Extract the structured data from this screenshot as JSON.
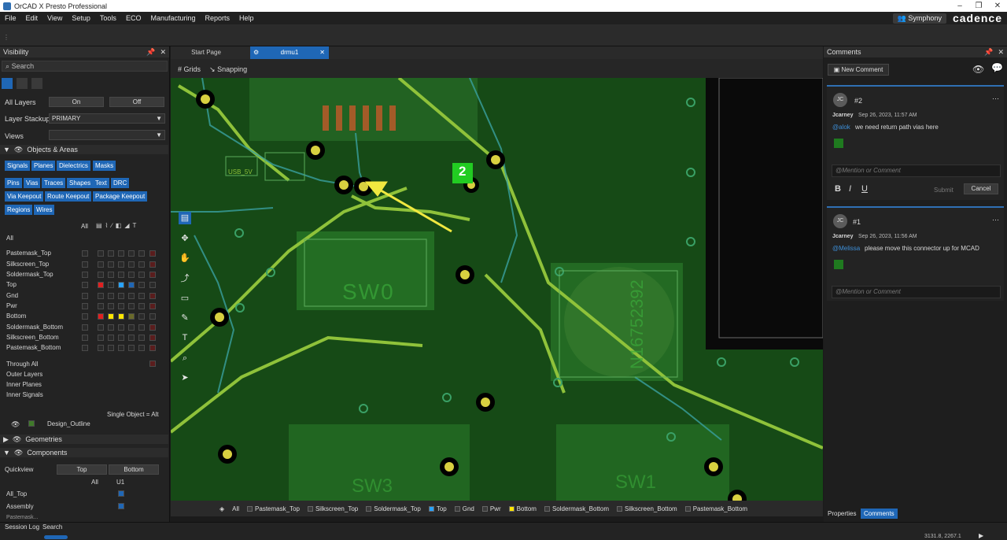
{
  "window": {
    "title": "OrCAD X Presto Professional"
  },
  "menu": [
    "File",
    "Edit",
    "View",
    "Setup",
    "Tools",
    "ECO",
    "Manufacturing",
    "Reports",
    "Help"
  ],
  "brand": {
    "symphony": "Symphony",
    "logo": "cadence"
  },
  "visibility": {
    "title": "Visibility",
    "search_placeholder": "Search",
    "all_layers_label": "All Layers",
    "on": "On",
    "off": "Off",
    "layer_stackup_label": "Layer Stackup",
    "layer_stackup_value": "PRIMARY",
    "views_label": "Views",
    "objects_areas": "Objects & Areas",
    "filters_row1": [
      "Signals",
      "Planes",
      "Dielectrics",
      "Masks"
    ],
    "filters_row2": [
      "Pins",
      "Vias",
      "Traces",
      "Shapes",
      "Text",
      "DRC"
    ],
    "filters_row3": [
      "Via Keepout",
      "Route Keepout",
      "Package Keepout"
    ],
    "filters_row4": [
      "Regions",
      "Wires"
    ],
    "all_col": "All",
    "all_row": "All",
    "layers": [
      "Pastemask_Top",
      "Silkscreen_Top",
      "Soldermask_Top",
      "Top",
      "Gnd",
      "Pwr",
      "Bottom",
      "Soldermask_Bottom",
      "Silkscreen_Bottom",
      "Pastemask_Bottom"
    ],
    "groups": [
      "Through All",
      "Outer Layers",
      "Inner Planes",
      "Inner Signals"
    ],
    "single_object": "Single Object = Alt",
    "design_outline": "Design_Outline",
    "geometries": "Geometries",
    "components": "Components",
    "quickview": "Quickview",
    "qv_top": "Top",
    "qv_bottom": "Bottom",
    "comp_all": "All",
    "comp_u1": "U1",
    "comp_rows": [
      "All_Top",
      "Assembly",
      "Pastemask..."
    ]
  },
  "tabs": {
    "start": "Start Page",
    "design": "drmu1"
  },
  "canvas_toolbar": {
    "grids": "Grids",
    "snapping": "Snapping"
  },
  "board_labels": {
    "usb": "USB_5V",
    "sw0": "SW0",
    "sw3": "SW3",
    "sw1": "SW1",
    "n": "N16752392",
    "marker": "2"
  },
  "layerbar": [
    {
      "label": "All",
      "color": ""
    },
    {
      "label": "Pastemask_Top",
      "color": "#3a3a3a"
    },
    {
      "label": "Silkscreen_Top",
      "color": "#3a3a3a"
    },
    {
      "label": "Soldermask_Top",
      "color": "#3a3a3a"
    },
    {
      "label": "Top",
      "color": "#29a3ff"
    },
    {
      "label": "Gnd",
      "color": "#3a3a3a"
    },
    {
      "label": "Pwr",
      "color": "#3a3a3a"
    },
    {
      "label": "Bottom",
      "color": "#ffe600"
    },
    {
      "label": "Soldermask_Bottom",
      "color": "#3a3a3a"
    },
    {
      "label": "Silkscreen_Bottom",
      "color": "#3a3a3a"
    },
    {
      "label": "Pastemask_Bottom",
      "color": "#3a3a3a"
    }
  ],
  "comments": {
    "title": "Comments",
    "new_comment": "New Comment",
    "items": [
      {
        "id": "#2",
        "initials": "JC",
        "author": "Jcarney",
        "time": "Sep 26, 2023, 11:57 AM",
        "mention": "@alok",
        "text": "we need return path vias here",
        "placeholder": "@Mention or Comment",
        "submit": "Submit",
        "cancel": "Cancel"
      },
      {
        "id": "#1",
        "initials": "JC",
        "author": "Jcarney",
        "time": "Sep 26, 2023, 11:56 AM",
        "mention": "@Melissa",
        "text": "please move this connector up for MCAD",
        "placeholder": "@Mention or Comment"
      }
    ],
    "bottom_tabs": [
      "Properties",
      "Comments"
    ]
  },
  "status": {
    "session_log": "Session Log",
    "search": "Search",
    "coords": "3131.8, 2267.1"
  },
  "colors": {
    "accent": "#1f67b6",
    "board": "#164a16",
    "trace": "#8fc23a",
    "pad": "#f0e040"
  }
}
